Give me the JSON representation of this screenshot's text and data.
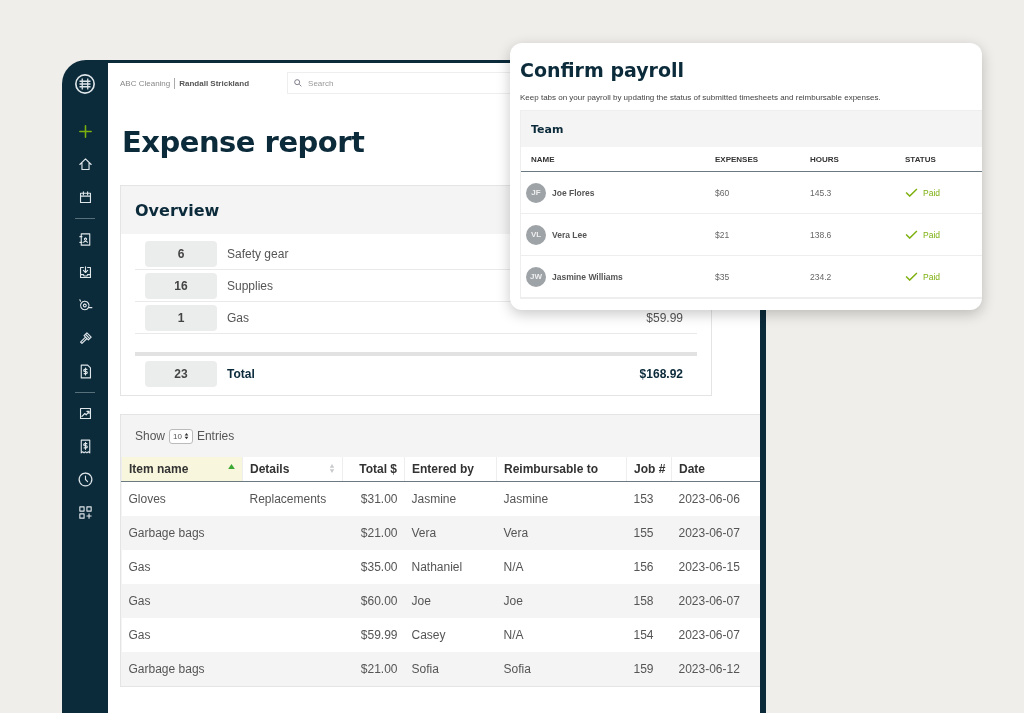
{
  "topbar": {
    "company": "ABC Cleaning",
    "user": "Randall Strickland",
    "search": {
      "placeholder": "Search"
    }
  },
  "page_title": "Expense report",
  "overview": {
    "title": "Overview",
    "rows": [
      {
        "count": "6",
        "category": "Safety gear"
      },
      {
        "count": "16",
        "category": "Supplies"
      },
      {
        "count": "1",
        "category": "Gas",
        "amount": "$59.99"
      }
    ],
    "total": {
      "count": "23",
      "label": "Total",
      "amount": "$168.92"
    }
  },
  "expenses": {
    "show_label": "Show",
    "page_size": "10",
    "entries_label": "Entries",
    "columns": [
      {
        "label": "Item name",
        "sortable": true,
        "sorted": true
      },
      {
        "label": "Details",
        "sortable": true,
        "sorted": false
      },
      {
        "label": "Total $",
        "sortable": false,
        "sorted": false
      },
      {
        "label": "Entered by",
        "sortable": false,
        "sorted": false
      },
      {
        "label": "Reimbursable to",
        "sortable": false,
        "sorted": false
      },
      {
        "label": "Job #",
        "sortable": false,
        "sorted": false
      },
      {
        "label": "Date",
        "sortable": false,
        "sorted": false
      }
    ],
    "rows": [
      [
        "Gloves",
        "Replacements",
        "$31.00",
        "Jasmine",
        "Jasmine",
        "153",
        "2023-06-06"
      ],
      [
        "Garbage bags",
        "",
        "$21.00",
        "Vera",
        "Vera",
        "155",
        "2023-06-07"
      ],
      [
        "Gas",
        "",
        "$35.00",
        "Nathaniel",
        "N/A",
        "156",
        "2023-06-15"
      ],
      [
        "Gas",
        "",
        "$60.00",
        "Joe",
        "Joe",
        "158",
        "2023-06-07"
      ],
      [
        "Gas",
        "",
        "$59.99",
        "Casey",
        "N/A",
        "154",
        "2023-06-07"
      ],
      [
        "Garbage bags",
        "",
        "$21.00",
        "Sofia",
        "Sofia",
        "159",
        "2023-06-12"
      ]
    ]
  },
  "payroll": {
    "title": "Confirm payroll",
    "description": "Keep tabs on your payroll by updating the status of submitted timesheets and reimbursable expenses.",
    "team_title": "Team",
    "columns": [
      "NAME",
      "EXPENSES",
      "HOURS",
      "STATUS"
    ],
    "rows": [
      {
        "initials": "JF",
        "name": "Joe Flores",
        "expenses": "$60",
        "hours": "145.3",
        "status": "Paid",
        "paid": true
      },
      {
        "initials": "VL",
        "name": "Vera Lee",
        "expenses": "$21",
        "hours": "138.6",
        "status": "Paid",
        "paid": true
      },
      {
        "initials": "JW",
        "name": "Jasmine Williams",
        "expenses": "$35",
        "hours": "234.2",
        "status": "Paid",
        "paid": true
      }
    ]
  }
}
